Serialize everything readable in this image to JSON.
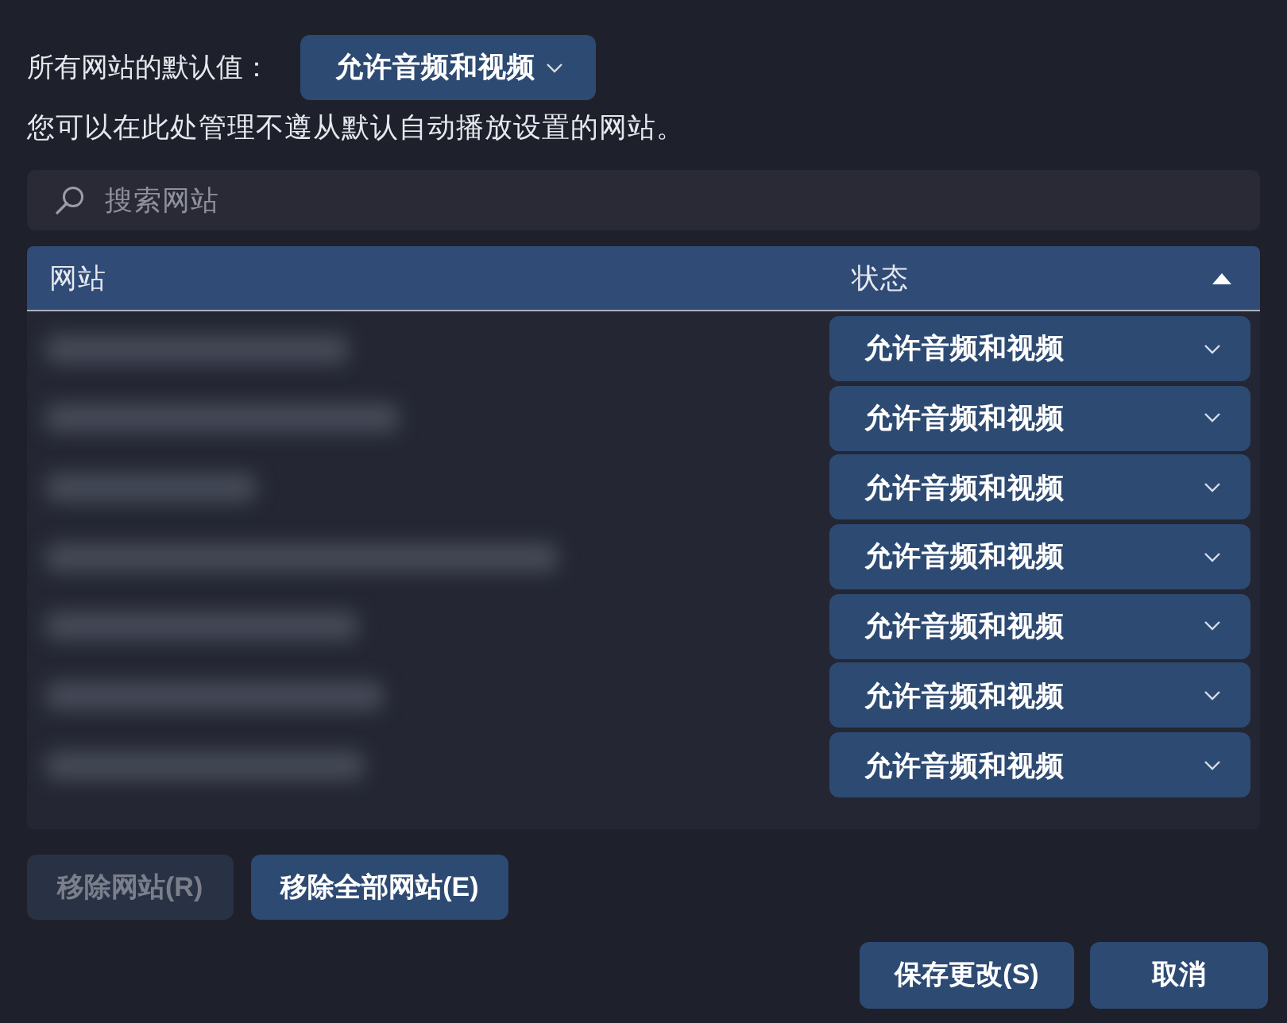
{
  "default_setting": {
    "label": "所有网站的默认值：",
    "value": "允许音频和视频"
  },
  "description": "您可以在此处管理不遵从默认自动播放设置的网站。",
  "search": {
    "placeholder": "搜索网站"
  },
  "table": {
    "columns": [
      {
        "label": "网站",
        "sorted": false
      },
      {
        "label": "状态",
        "sorted": true
      }
    ],
    "rows": [
      {
        "status": "允许音频和视频"
      },
      {
        "status": "允许音频和视频"
      },
      {
        "status": "允许音频和视频"
      },
      {
        "status": "允许音频和视频"
      },
      {
        "status": "允许音频和视频"
      },
      {
        "status": "允许音频和视频"
      },
      {
        "status": "允许音频和视频"
      }
    ]
  },
  "buttons": [
    {
      "label": "移除网站(R)",
      "disabled": true
    },
    {
      "label": "移除全部网站(E)",
      "disabled": false
    }
  ],
  "dialog_buttons": [
    {
      "label": "保存更改(S)"
    },
    {
      "label": "取消"
    }
  ]
}
